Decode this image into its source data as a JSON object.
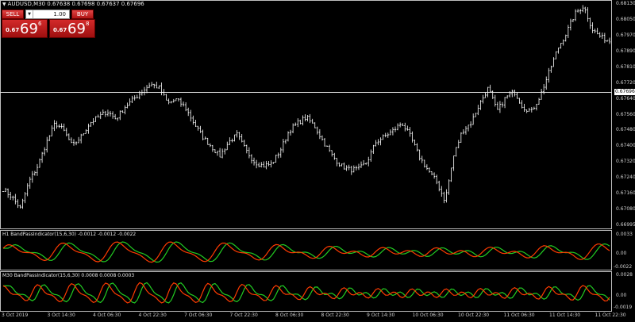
{
  "symbol_title": "AUDUSD,M30  0.67638 0.67698 0.67637 0.67696",
  "trade_panel": {
    "sell_label": "SELL",
    "buy_label": "BUY",
    "lot_value": "1.00",
    "sell_price": {
      "small": "0.67",
      "big": "69",
      "sup": "6"
    },
    "buy_price": {
      "small": "0.67",
      "big": "69",
      "sup": "8"
    }
  },
  "price_axis": {
    "labels": [
      "0.68130",
      "0.68050",
      "0.67970",
      "0.67890",
      "0.67810",
      "0.67720",
      "0.67640",
      "0.67560",
      "0.67480",
      "0.67400",
      "0.67320",
      "0.67240",
      "0.67160",
      "0.67080",
      "0.66995"
    ],
    "current": "0.67696",
    "min": 0.66995,
    "max": 0.6813
  },
  "indicator1": {
    "title": "H1 BandPassIndicator(15,6,30) -0.0012 -0.0012 -0.0022",
    "axis": [
      "0.0033",
      "0.00",
      "-0.0022"
    ]
  },
  "indicator2": {
    "title": "M30 BandPassIndicator(15,6,30) 0.0008 0.0008 0.0003",
    "axis": [
      "0.0028",
      "0.00",
      "-0.0019"
    ]
  },
  "time_axis": [
    "3 Oct 2019",
    "3 Oct 14:30",
    "4 Oct 06:30",
    "4 Oct 22:30",
    "7 Oct 06:30",
    "7 Oct 22:30",
    "8 Oct 06:30",
    "8 Oct 22:30",
    "9 Oct 14:30",
    "10 Oct 06:30",
    "10 Oct 22:30",
    "11 Oct 06:30",
    "11 Oct 14:30",
    "11 Oct 22:30"
  ],
  "chart_data": {
    "type": "ohlc",
    "symbol": "AUDUSD",
    "timeframe": "M30",
    "close_path": [
      0.6718,
      0.6714,
      0.6708,
      0.6722,
      0.673,
      0.6742,
      0.6752,
      0.6748,
      0.674,
      0.6745,
      0.6752,
      0.6755,
      0.6758,
      0.6754,
      0.676,
      0.6764,
      0.6768,
      0.6772,
      0.677,
      0.6762,
      0.6764,
      0.676,
      0.6752,
      0.6745,
      0.674,
      0.6735,
      0.6742,
      0.6746,
      0.6738,
      0.6732,
      0.673,
      0.6731,
      0.6738,
      0.6748,
      0.6752,
      0.6755,
      0.675,
      0.6742,
      0.6735,
      0.673,
      0.6728,
      0.6728,
      0.6732,
      0.6742,
      0.6745,
      0.6748,
      0.6752,
      0.6745,
      0.6735,
      0.6728,
      0.6722,
      0.6712,
      0.6735,
      0.6748,
      0.6752,
      0.6762,
      0.677,
      0.6758,
      0.6765,
      0.6768,
      0.676,
      0.6758,
      0.6766,
      0.6778,
      0.679,
      0.6798,
      0.6808,
      0.6812,
      0.68,
      0.6796,
      0.6794
    ],
    "colors": {
      "bars": "#ffffff",
      "fast_line": "#ff3b00",
      "slow_line": "#22cc22",
      "background": "#000000"
    }
  }
}
